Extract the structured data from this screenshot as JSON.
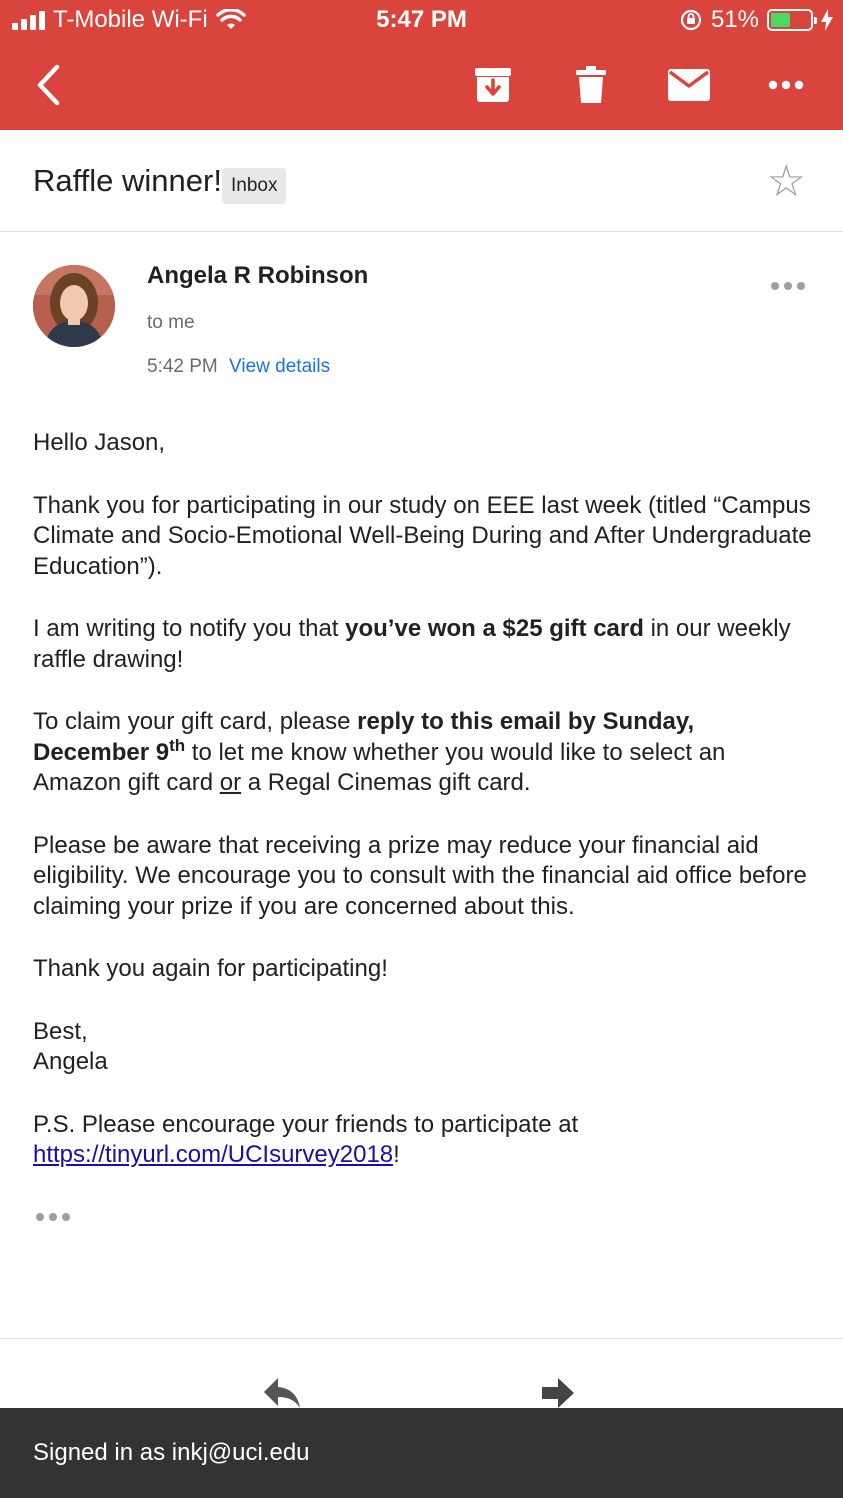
{
  "status_bar": {
    "carrier": "T-Mobile Wi-Fi",
    "time": "5:47 PM",
    "battery": "51%",
    "battery_level": 0.51,
    "icons": [
      "signal-icon",
      "wifi-icon",
      "orientation-lock-icon",
      "battery-icon",
      "charging-icon"
    ]
  },
  "toolbar": {
    "icons": [
      "back-icon",
      "archive-icon",
      "delete-icon",
      "mark-unread-icon",
      "more-icon"
    ]
  },
  "email": {
    "subject": "Raffle winner!",
    "label": "Inbox",
    "sender": "Angela R Robinson",
    "recipient": "to me",
    "time": "5:42 PM",
    "view_details": "View details",
    "body": {
      "greeting": "Hello Jason,",
      "p1": "Thank you for participating in our study on EEE last week (titled “Campus Climate and Socio-Emotional Well-Being During and After Undergraduate Education”).",
      "p2_pre": "I am writing to notify you that ",
      "p2_bold": "you’ve won a $25 gift card",
      "p2_post": " in our weekly raffle drawing!",
      "p3_pre": "To claim your gift card, please ",
      "p3_bold": "reply to this email by Sunday, December 9",
      "p3_sup": "th",
      "p3_mid": " to let me know whether you would like to select an Amazon gift card ",
      "p3_or": "or",
      "p3_post": " a Regal Cinemas gift card.",
      "p4": "Please be aware that receiving a prize may reduce your financial aid eligibility. We encourage you to consult with the financial aid office before claiming your prize if you are concerned about this.",
      "p5": "Thank you again for participating!",
      "signoff": "Best,",
      "signature": "Angela",
      "ps_pre": "P.S. Please encourage your friends to participate at",
      "ps_link": "https://tinyurl.com/UCIsurvey2018",
      "ps_post": "!"
    }
  },
  "footer": {
    "signed_in": "Signed in as inkj@uci.edu"
  },
  "colors": {
    "header": "#d9453c",
    "link": "#1a73e8",
    "footer": "#333333"
  }
}
